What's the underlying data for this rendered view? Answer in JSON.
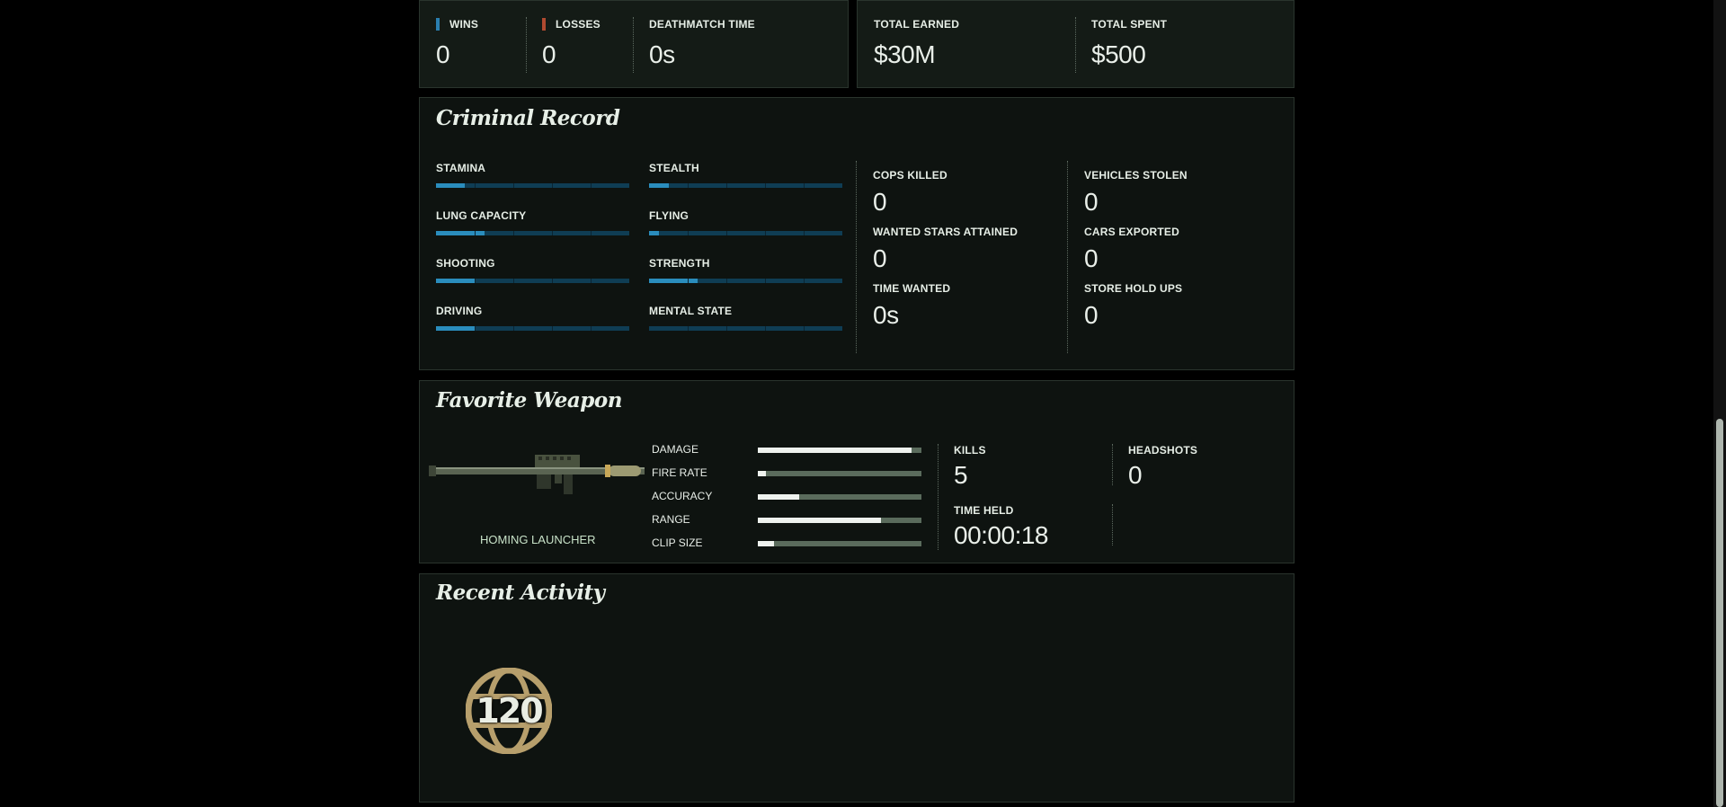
{
  "match_stats": {
    "wins_label": "WINS",
    "wins": "0",
    "losses_label": "LOSSES",
    "losses": "0",
    "deathmatch_label": "DEATHMATCH TIME",
    "deathmatch_time": "0s",
    "wins_color": "#2a7fb0",
    "losses_color": "#b04a30"
  },
  "money": {
    "earned_label": "TOTAL EARNED",
    "earned": "$30M",
    "spent_label": "TOTAL SPENT",
    "spent": "$500"
  },
  "criminal_record": {
    "title": "Criminal Record",
    "skills": [
      {
        "label": "STAMINA",
        "level": 0.15
      },
      {
        "label": "STEALTH",
        "level": 0.1
      },
      {
        "label": "LUNG CAPACITY",
        "level": 0.25
      },
      {
        "label": "FLYING",
        "level": 0.05
      },
      {
        "label": "SHOOTING",
        "level": 0.2
      },
      {
        "label": "STRENGTH",
        "level": 0.25
      },
      {
        "label": "DRIVING",
        "level": 0.2
      },
      {
        "label": "MENTAL STATE",
        "level": 0.0
      }
    ],
    "stats": {
      "cops_killed_label": "COPS KILLED",
      "cops_killed": "0",
      "wanted_stars_label": "WANTED STARS ATTAINED",
      "wanted_stars": "0",
      "time_wanted_label": "TIME WANTED",
      "time_wanted": "0s",
      "vehicles_stolen_label": "VEHICLES STOLEN",
      "vehicles_stolen": "0",
      "cars_exported_label": "CARS EXPORTED",
      "cars_exported": "0",
      "store_hold_ups_label": "STORE HOLD UPS",
      "store_hold_ups": "0"
    }
  },
  "favorite_weapon": {
    "title": "Favorite Weapon",
    "name": "HOMING LAUNCHER",
    "icon": "homing-launcher-icon",
    "attributes": [
      {
        "label": "DAMAGE",
        "level": 0.94
      },
      {
        "label": "FIRE RATE",
        "level": 0.05
      },
      {
        "label": "ACCURACY",
        "level": 0.25
      },
      {
        "label": "RANGE",
        "level": 0.75
      },
      {
        "label": "CLIP SIZE",
        "level": 0.1
      }
    ],
    "kills_label": "KILLS",
    "kills": "5",
    "headshots_label": "HEADSHOTS",
    "headshots": "0",
    "time_held_label": "TIME HELD",
    "time_held": "00:00:18"
  },
  "recent_activity": {
    "title": "Recent Activity",
    "rank_badge": "120",
    "badge_icon": "rank-globe-icon"
  }
}
